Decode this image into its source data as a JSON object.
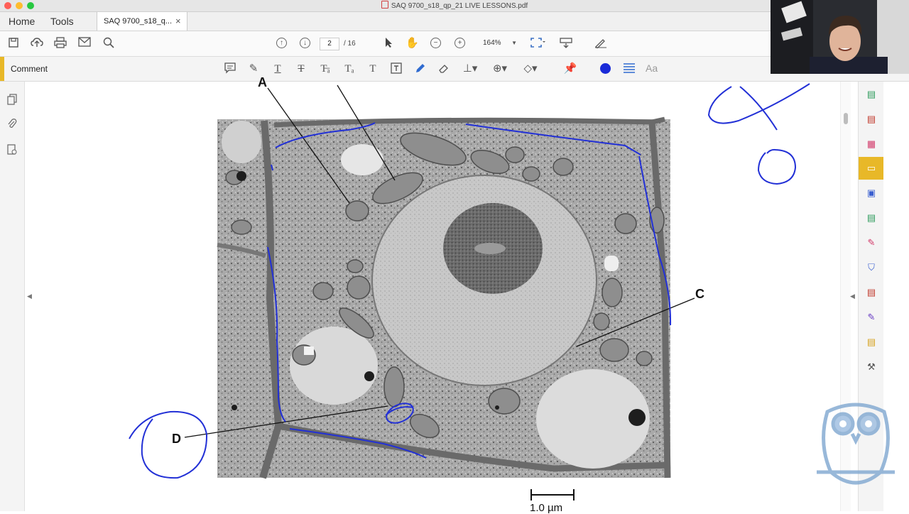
{
  "window": {
    "title": "SAQ 9700_s18_qp_21 LIVE LESSONS.pdf",
    "traffic_colors": [
      "#ff5f57",
      "#febc2e",
      "#28c840"
    ]
  },
  "menu": {
    "home": "Home",
    "tools": "Tools",
    "doc_tab": "SAQ 9700_s18_q...",
    "doc_tab_close": "×"
  },
  "toolbar": {
    "icons": [
      "save-icon",
      "cloud-upload-icon",
      "print-icon",
      "mail-icon",
      "search-icon",
      "page-up-icon",
      "page-down-icon",
      "select-arrow-icon",
      "hand-icon",
      "zoom-out-icon",
      "zoom-in-icon",
      "fit-page-icon",
      "scroll-mode-icon",
      "sign-icon"
    ],
    "current_page": "2",
    "total_pages": "/ 16",
    "zoom": "164%"
  },
  "comment_bar": {
    "label": "Comment",
    "accent_color": "#e8b828",
    "pen_color": "#1a2bd8",
    "text_tool": "Aa",
    "icons": [
      "sticky-note-icon",
      "highlight-icon",
      "underline-text-icon",
      "strikethrough-icon",
      "replace-text-icon",
      "insert-text-icon",
      "add-text-icon",
      "text-box-icon",
      "draw-pen-icon",
      "eraser-icon",
      "stamp-icon",
      "attach-icon",
      "shapes-icon",
      "pin-icon",
      "color-swatch-icon",
      "line-width-icon"
    ]
  },
  "left_nav": {
    "icons": [
      "page-thumbnails-icon",
      "attachments-icon",
      "document-properties-icon"
    ]
  },
  "right_panel": {
    "icons": [
      "create-pdf-icon",
      "export-pdf-icon",
      "organize-pages-icon",
      "comment-icon",
      "combine-files-icon",
      "compress-icon",
      "fill-sign-icon",
      "protect-icon",
      "pdf-icon",
      "edit-icon",
      "export-icon",
      "more-tools-icon"
    ]
  },
  "document": {
    "labels": {
      "a": "A",
      "c": "C",
      "d": "D"
    },
    "scale_bar": "1.0 µm"
  }
}
